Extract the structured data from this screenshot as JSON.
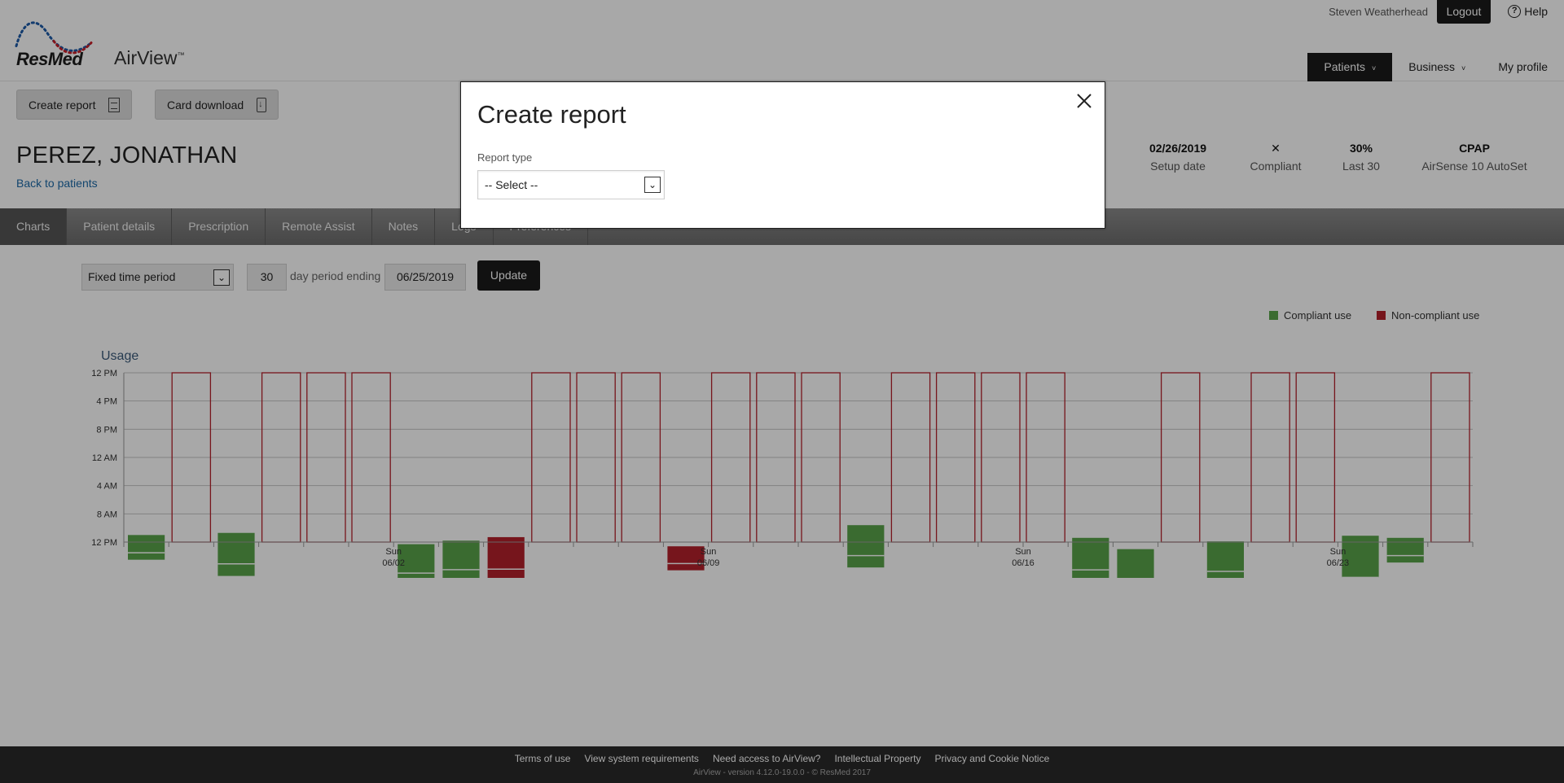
{
  "header": {
    "brand": "ResMed",
    "product": "AirView",
    "product_mark": "™",
    "user_name": "Steven Weatherhead",
    "logout_label": "Logout",
    "help_label": "Help",
    "nav": [
      {
        "label": "Patients",
        "caret": "˅"
      },
      {
        "label": "Business",
        "caret": "˅"
      },
      {
        "label": "My profile"
      }
    ]
  },
  "toolbar": {
    "create_report_label": "Create report",
    "card_download_label": "Card download"
  },
  "patient": {
    "name": "PEREZ, JONATHAN",
    "back_label": "Back to patients"
  },
  "summary": [
    {
      "value": "02/26/2019",
      "label": "Setup date"
    },
    {
      "icon": "✕",
      "label": "Compliant"
    },
    {
      "value": "30%",
      "label": "Last 30"
    },
    {
      "value": "CPAP",
      "label": "AirSense 10 AutoSet"
    }
  ],
  "tabs": [
    "Charts",
    "Patient details",
    "Prescription",
    "Remote Assist",
    "Notes",
    "Logs",
    "Preferences"
  ],
  "controls": {
    "period_type": "Fixed time period",
    "days": "30",
    "period_label": "day period ending",
    "end_date": "06/25/2019",
    "update_label": "Update"
  },
  "legend": [
    {
      "label": "Compliant use",
      "color": "#58a34a"
    },
    {
      "label": "Non-compliant use",
      "color": "#b3202b"
    }
  ],
  "chart_data": {
    "type": "bar",
    "title": "Usage",
    "y_ticks": [
      "12 PM",
      "4 PM",
      "8 PM",
      "12 AM",
      "4 AM",
      "8 AM",
      "12 PM"
    ],
    "x_labels": [
      {
        "day": "Sun",
        "date": "06/02"
      },
      {
        "day": "Sun",
        "date": "06/09"
      },
      {
        "day": "Sun",
        "date": "06/16"
      },
      {
        "day": "Sun",
        "date": "06/23"
      }
    ],
    "compliant_color": "#58a34a",
    "noncompliant_color": "#b3202b",
    "days": [
      {
        "date": "05/27",
        "status": "compliant",
        "sessions": [
          [
            23.0,
            26.5
          ]
        ]
      },
      {
        "date": "05/28",
        "status": "none",
        "sessions": []
      },
      {
        "date": "05/29",
        "status": "compliant",
        "sessions": [
          [
            22.7,
            28.8
          ]
        ]
      },
      {
        "date": "05/30",
        "status": "none",
        "sessions": []
      },
      {
        "date": "05/31",
        "status": "none",
        "sessions": []
      },
      {
        "date": "06/01",
        "status": "none",
        "sessions": []
      },
      {
        "date": "06/02",
        "status": "compliant",
        "sessions": [
          [
            24.3,
            30.0
          ]
        ]
      },
      {
        "date": "06/03",
        "status": "compliant",
        "sessions": [
          [
            23.8,
            29.5
          ]
        ]
      },
      {
        "date": "06/04",
        "status": "noncompliant",
        "sessions": [
          [
            23.3,
            29.6
          ]
        ]
      },
      {
        "date": "06/05",
        "status": "none",
        "sessions": []
      },
      {
        "date": "06/06",
        "status": "none",
        "sessions": []
      },
      {
        "date": "06/07",
        "status": "none",
        "sessions": []
      },
      {
        "date": "06/08",
        "status": "noncompliant",
        "sessions": [
          [
            24.6,
            28.0
          ]
        ]
      },
      {
        "date": "06/09",
        "status": "none",
        "sessions": []
      },
      {
        "date": "06/10",
        "status": "none",
        "sessions": []
      },
      {
        "date": "06/11",
        "status": "none",
        "sessions": []
      },
      {
        "date": "06/12",
        "status": "compliant",
        "sessions": [
          [
            21.6,
            27.6
          ]
        ]
      },
      {
        "date": "06/13",
        "status": "none",
        "sessions": []
      },
      {
        "date": "06/14",
        "status": "none",
        "sessions": []
      },
      {
        "date": "06/15",
        "status": "none",
        "sessions": []
      },
      {
        "date": "06/16",
        "status": "none",
        "sessions": []
      },
      {
        "date": "06/17",
        "status": "compliant",
        "sessions": [
          [
            23.4,
            29.7
          ]
        ]
      },
      {
        "date": "06/18",
        "status": "compliant",
        "sessions": [
          [
            25.0,
            31.4
          ]
        ]
      },
      {
        "date": "06/19",
        "status": "none",
        "sessions": []
      },
      {
        "date": "06/20",
        "status": "compliant",
        "sessions": [
          [
            23.9,
            29.8
          ]
        ]
      },
      {
        "date": "06/21",
        "status": "none",
        "sessions": []
      },
      {
        "date": "06/22",
        "status": "none",
        "sessions": []
      },
      {
        "date": "06/23",
        "status": "compliant",
        "sessions": [
          [
            23.1,
            31.3
          ]
        ]
      },
      {
        "date": "06/24",
        "status": "compliant",
        "sessions": [
          [
            23.4,
            26.9
          ]
        ]
      },
      {
        "date": "06/25",
        "status": "none",
        "sessions": []
      }
    ]
  },
  "footer": {
    "links": [
      "Terms of use",
      "View system requirements",
      "Need access to AirView?",
      "Intellectual Property",
      "Privacy and Cookie Notice"
    ],
    "version": "AirView - version 4.12.0-19.0.0  - © ResMed 2017"
  },
  "modal": {
    "title": "Create report",
    "report_type_label": "Report type",
    "report_type_value": "-- Select --"
  }
}
